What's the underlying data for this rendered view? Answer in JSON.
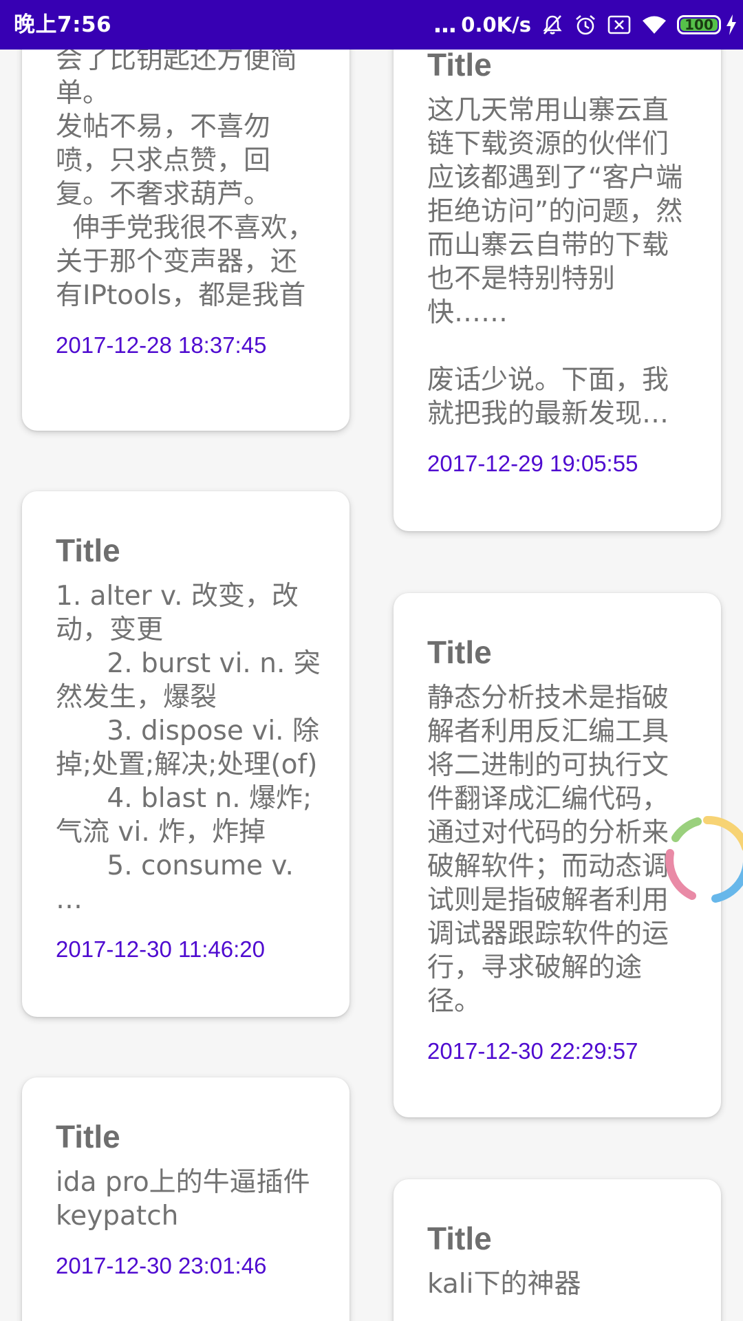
{
  "status_bar": {
    "time": "晚上7:56",
    "more_dots": "...",
    "net_speed": "0.0K/s",
    "battery_level": "100",
    "battery_fraction": 1.0,
    "icons": [
      "mute-icon",
      "alarm-icon",
      "sim-off-icon",
      "wifi-icon",
      "battery-icon",
      "charging-icon"
    ]
  },
  "colors": {
    "status_bar_bg": "#3700b3",
    "date_text": "#4f0bd0",
    "title_text": "#6e6e6e",
    "body_text": "#727272"
  },
  "cards": [
    {
      "title": "",
      "body": "会了比钥匙还方便简单。\n发帖不易，不喜勿喷，只求点赞，回复。不奢求葫芦。\n  伸手党我很不喜欢，关于那个变声器，还有IPtools，都是我首发的，但…",
      "date": "2017-12-28 18:37:45"
    },
    {
      "title": "Title",
      "body": "这几天常用山寨云直链下载资源的伙伴们应该都遇到了“客户端拒绝访问”的问题，然而山寨云自带的下载也不是特别特别快……\n\n废话少说。下面，我就把我的最新发现…",
      "date": "2017-12-29 19:05:55"
    },
    {
      "title": "Title",
      "body": "1. alter v. 改变，改动，变更\n      2. burst vi. n. 突然发生，爆裂\n      3. dispose vi. 除掉;处置;解决;处理(of)\n      4. blast n. 爆炸;气流 vi. 炸，炸掉\n      5. consume v. …",
      "date": "2017-12-30 11:46:20"
    },
    {
      "title": "Title",
      "body": "静态分析技术是指破解者利用反汇编工具将二进制的可执行文件翻译成汇编代码，通过对代码的分析来破解软件；而动态调试则是指破解者利用调试器跟踪软件的运行，寻求破解的途径。",
      "date": "2017-12-30 22:29:57"
    },
    {
      "title": "Title",
      "body": "ida pro上的牛逼插件keypatch",
      "date": "2017-12-30 23:01:46"
    },
    {
      "title": "Title",
      "body": "kali下的神器",
      "date": ""
    }
  ]
}
